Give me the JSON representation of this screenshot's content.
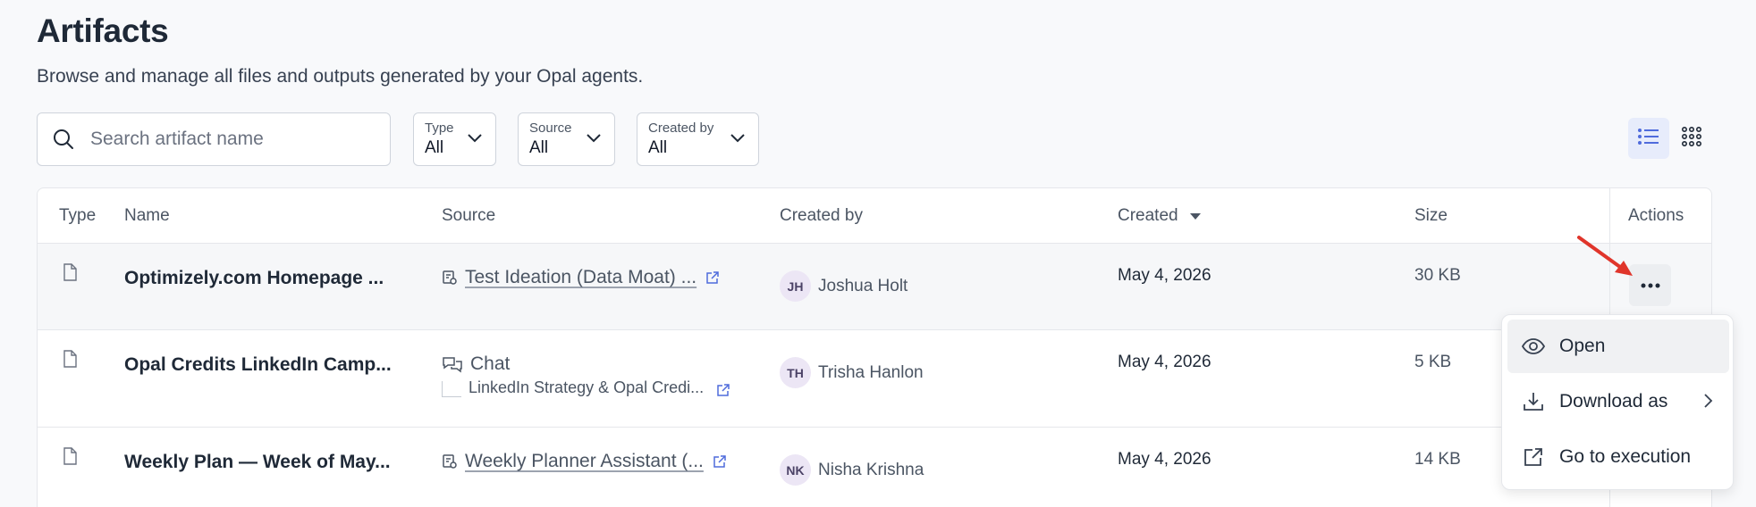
{
  "page": {
    "title": "Artifacts",
    "subtitle": "Browse and manage all files and outputs generated by your Opal agents."
  },
  "toolbar": {
    "search_placeholder": "Search artifact name",
    "filters": [
      {
        "label": "Type",
        "value": "All"
      },
      {
        "label": "Source",
        "value": "All"
      },
      {
        "label": "Created by",
        "value": "All"
      }
    ],
    "view_modes": [
      "list-icon",
      "grid-icon"
    ],
    "active_view": "list"
  },
  "table": {
    "columns": {
      "type": "Type",
      "name": "Name",
      "source": "Source",
      "created_by": "Created by",
      "created": "Created",
      "size": "Size",
      "actions": "Actions"
    },
    "sort": {
      "column": "Created",
      "direction": "desc"
    },
    "rows": [
      {
        "name": "Optimizely.com Homepage ...",
        "source_icon": "workflow-icon",
        "source": "Test Ideation (Data Moat) ...",
        "initials": "JH",
        "creator": "Joshua Holt",
        "created": "May 4, 2026",
        "size": "30 KB"
      },
      {
        "name": "Opal Credits LinkedIn Camp...",
        "source_icon": "chat-icon",
        "source": "Chat",
        "sub_source": "LinkedIn Strategy & Opal Credi...",
        "initials": "TH",
        "creator": "Trisha Hanlon",
        "created": "May 4, 2026",
        "size": "5 KB"
      },
      {
        "name": "Weekly Plan — Week of May...",
        "source_icon": "workflow-icon",
        "source": "Weekly Planner Assistant (...",
        "initials": "NK",
        "creator": "Nisha Krishna",
        "created": "May 4, 2026",
        "size": "14 KB"
      }
    ]
  },
  "menu": {
    "items": [
      {
        "label": "Open",
        "icon": "eye-icon"
      },
      {
        "label": "Download as",
        "icon": "download-icon"
      },
      {
        "label": "Go to execution",
        "icon": "external-link-icon"
      }
    ]
  },
  "colors": {
    "accent": "#4f6bdc",
    "annotation_arrow": "#e0352b",
    "avatar_bg": "#ece6f5"
  }
}
